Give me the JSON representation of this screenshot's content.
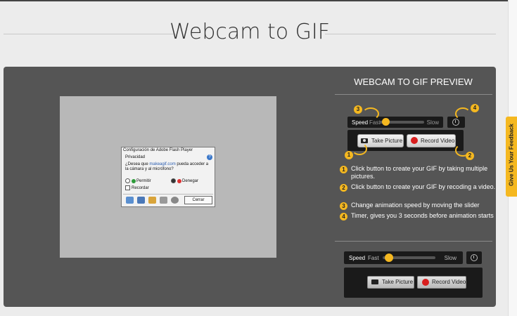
{
  "page": {
    "title": "Webcam to GIF"
  },
  "flash_dialog": {
    "title": "Configuración de Adobe Flash Player",
    "heading": "Privacidad",
    "help": "?",
    "question_prefix": "¿Desea que",
    "question_link": "makeagif.com",
    "question_suffix": "pueda acceder a la cámara y al micrófono?",
    "allow": "Permitir",
    "deny": "Denegar",
    "remember": "Recordar",
    "close": "Cerrar"
  },
  "preview": {
    "title": "WEBCAM TO GIF PREVIEW",
    "speed_label": "Speed",
    "fast_label": "Fast",
    "slow_label": "Slow",
    "take_picture": "Take Picture",
    "record_video": "Record Video",
    "callouts": [
      "1",
      "2",
      "3",
      "4"
    ]
  },
  "steps": [
    {
      "num": "1",
      "text": "Click button to create your GIF by taking multiple pictures."
    },
    {
      "num": "2",
      "text": "Click button to create your GIF by recoding a video."
    },
    {
      "num": "3",
      "text": "Change animation speed by moving the slider"
    },
    {
      "num": "4",
      "text": "Timer, gives you 3 seconds before animation starts"
    }
  ],
  "controls": {
    "speed_label": "Speed",
    "fast_label": "Fast",
    "slow_label": "Slow",
    "take_picture": "Take Picture",
    "record_video": "Record Video"
  },
  "feedback": {
    "label": "Give Us Your Feedback"
  },
  "colors": {
    "accent": "#f5b820",
    "panel": "#555555",
    "record": "#d81e1e"
  }
}
